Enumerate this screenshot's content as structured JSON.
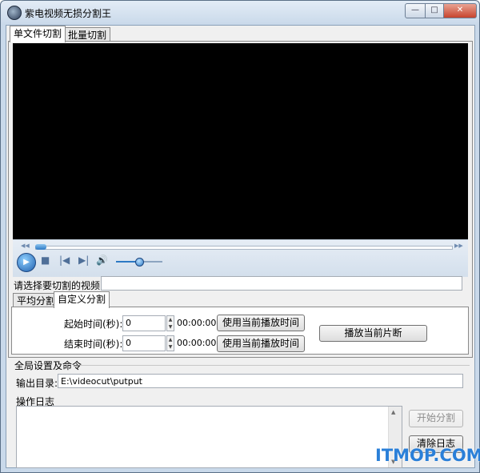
{
  "window": {
    "title": "紫电视频无损分割王",
    "min_glyph": "—",
    "max_glyph": "□",
    "close_glyph": "✕"
  },
  "tabs_main": [
    {
      "label": "单文件切割",
      "active": true
    },
    {
      "label": "批量切割",
      "active": false
    }
  ],
  "player": {
    "seek_left_glyph": "◀◀",
    "seek_right_glyph": "▶▶",
    "play_glyph": "▶",
    "stop_glyph": "■",
    "prev_glyph": "|◀",
    "next_glyph": "▶|",
    "volume_glyph": "🔊",
    "volume_level": 0.5
  },
  "video_select": {
    "label": "请选择要切割的视频:",
    "value": ""
  },
  "tabs_split": [
    {
      "label": "平均分割",
      "active": false
    },
    {
      "label": "自定义分割",
      "active": true
    }
  ],
  "custom_split": {
    "start": {
      "label": "起始时间(秒):",
      "value": "0",
      "time": "00:00:00",
      "button": "使用当前播放时间"
    },
    "end": {
      "label": "结束时间(秒):",
      "value": "0",
      "time": "00:00:00",
      "button": "使用当前播放时间"
    },
    "play_segment_button": "播放当前片断"
  },
  "global": {
    "section_title": "全局设置及命令",
    "output_label": "输出目录:",
    "output_value": "E:\\videocut\\putput",
    "log_label": "操作日志",
    "start_button": "开始分割",
    "clear_button": "清除日志"
  },
  "watermark": "ITMOP.COM",
  "colors": {
    "accent": "#2a7fd8",
    "video_bg": "#000000"
  }
}
